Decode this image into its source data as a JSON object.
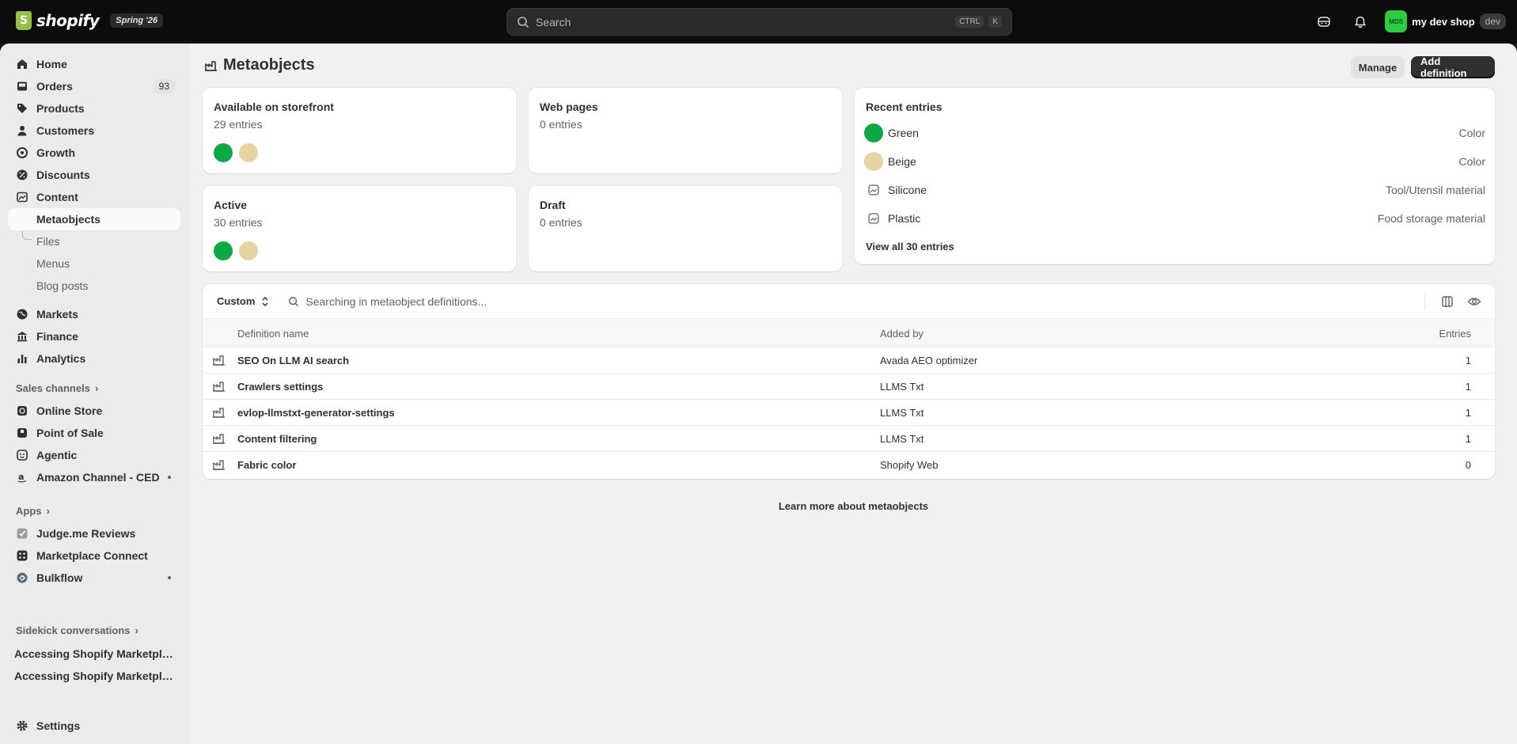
{
  "topbar": {
    "logo_text": "shopify",
    "edition": "Spring '26",
    "search_placeholder": "Search",
    "shortcut_keys": [
      "CTRL",
      "K"
    ],
    "store_initials": "MDS",
    "store_name": "my dev shop",
    "store_tag": "dev"
  },
  "sidebar": {
    "main": [
      {
        "label": "Home",
        "icon": "home-icon"
      },
      {
        "label": "Orders",
        "icon": "inbox-icon",
        "badge": "93"
      },
      {
        "label": "Products",
        "icon": "tag-icon"
      },
      {
        "label": "Customers",
        "icon": "person-icon"
      },
      {
        "label": "Growth",
        "icon": "growth-icon"
      },
      {
        "label": "Discounts",
        "icon": "discount-icon"
      },
      {
        "label": "Content",
        "icon": "content-icon"
      }
    ],
    "content_sub": [
      "Metaobjects",
      "Files",
      "Menus",
      "Blog posts"
    ],
    "secondary": [
      {
        "label": "Markets",
        "icon": "globe-icon"
      },
      {
        "label": "Finance",
        "icon": "bank-icon"
      },
      {
        "label": "Analytics",
        "icon": "bar-chart-icon"
      }
    ],
    "sales_channels_head": "Sales channels",
    "sales_channels": [
      {
        "label": "Online Store",
        "icon": "store-icon"
      },
      {
        "label": "Point of Sale",
        "icon": "pos-icon"
      },
      {
        "label": "Agentic",
        "icon": "agentic-icon"
      },
      {
        "label": "Amazon Channel - CED",
        "icon": "amazon-icon"
      }
    ],
    "apps_head": "Apps",
    "apps": [
      {
        "label": "Judge.me Reviews",
        "icon": "judgeme-icon"
      },
      {
        "label": "Marketplace Connect",
        "icon": "marketplace-icon"
      },
      {
        "label": "Bulkflow",
        "icon": "bulkflow-icon"
      }
    ],
    "sidekick_head": "Sidekick conversations",
    "conversations": [
      "Accessing Shopify Marketplac...",
      "Accessing Shopify Marketplac..."
    ],
    "settings": "Settings"
  },
  "page": {
    "title": "Metaobjects",
    "manage_label": "Manage",
    "add_label": "Add definition"
  },
  "stats": {
    "storefront": {
      "title": "Available on storefront",
      "sub": "29 entries"
    },
    "webpages": {
      "title": "Web pages",
      "sub": "0 entries"
    },
    "active": {
      "title": "Active",
      "sub": "30 entries"
    },
    "draft": {
      "title": "Draft",
      "sub": "0 entries"
    }
  },
  "swatch_colors": {
    "green": "#0da843",
    "beige": "#e8d3a3"
  },
  "recent": {
    "title": "Recent entries",
    "rows": [
      {
        "name": "Green",
        "type": "Color"
      },
      {
        "name": "Beige",
        "type": "Color"
      },
      {
        "name": "Silicone",
        "type": "Tool/Utensil material"
      },
      {
        "name": "Plastic",
        "type": "Food storage material"
      }
    ],
    "view_all": "View all 30 entries"
  },
  "table": {
    "filter_label": "Custom",
    "search_placeholder": "Searching in metaobject definitions...",
    "headers": {
      "name": "Definition name",
      "added_by": "Added by",
      "entries": "Entries"
    },
    "rows": [
      {
        "name": "SEO On LLM AI search",
        "added_by": "Avada AEO optimizer",
        "entries": "1"
      },
      {
        "name": "Crawlers settings",
        "added_by": "LLMS Txt",
        "entries": "1"
      },
      {
        "name": "evlop-llmstxt-generator-settings",
        "added_by": "LLMS Txt",
        "entries": "1"
      },
      {
        "name": "Content filtering",
        "added_by": "LLMS Txt",
        "entries": "1"
      },
      {
        "name": "Fabric color",
        "added_by": "Shopify Web",
        "entries": "0"
      }
    ]
  },
  "learn_more": "Learn more about metaobjects"
}
